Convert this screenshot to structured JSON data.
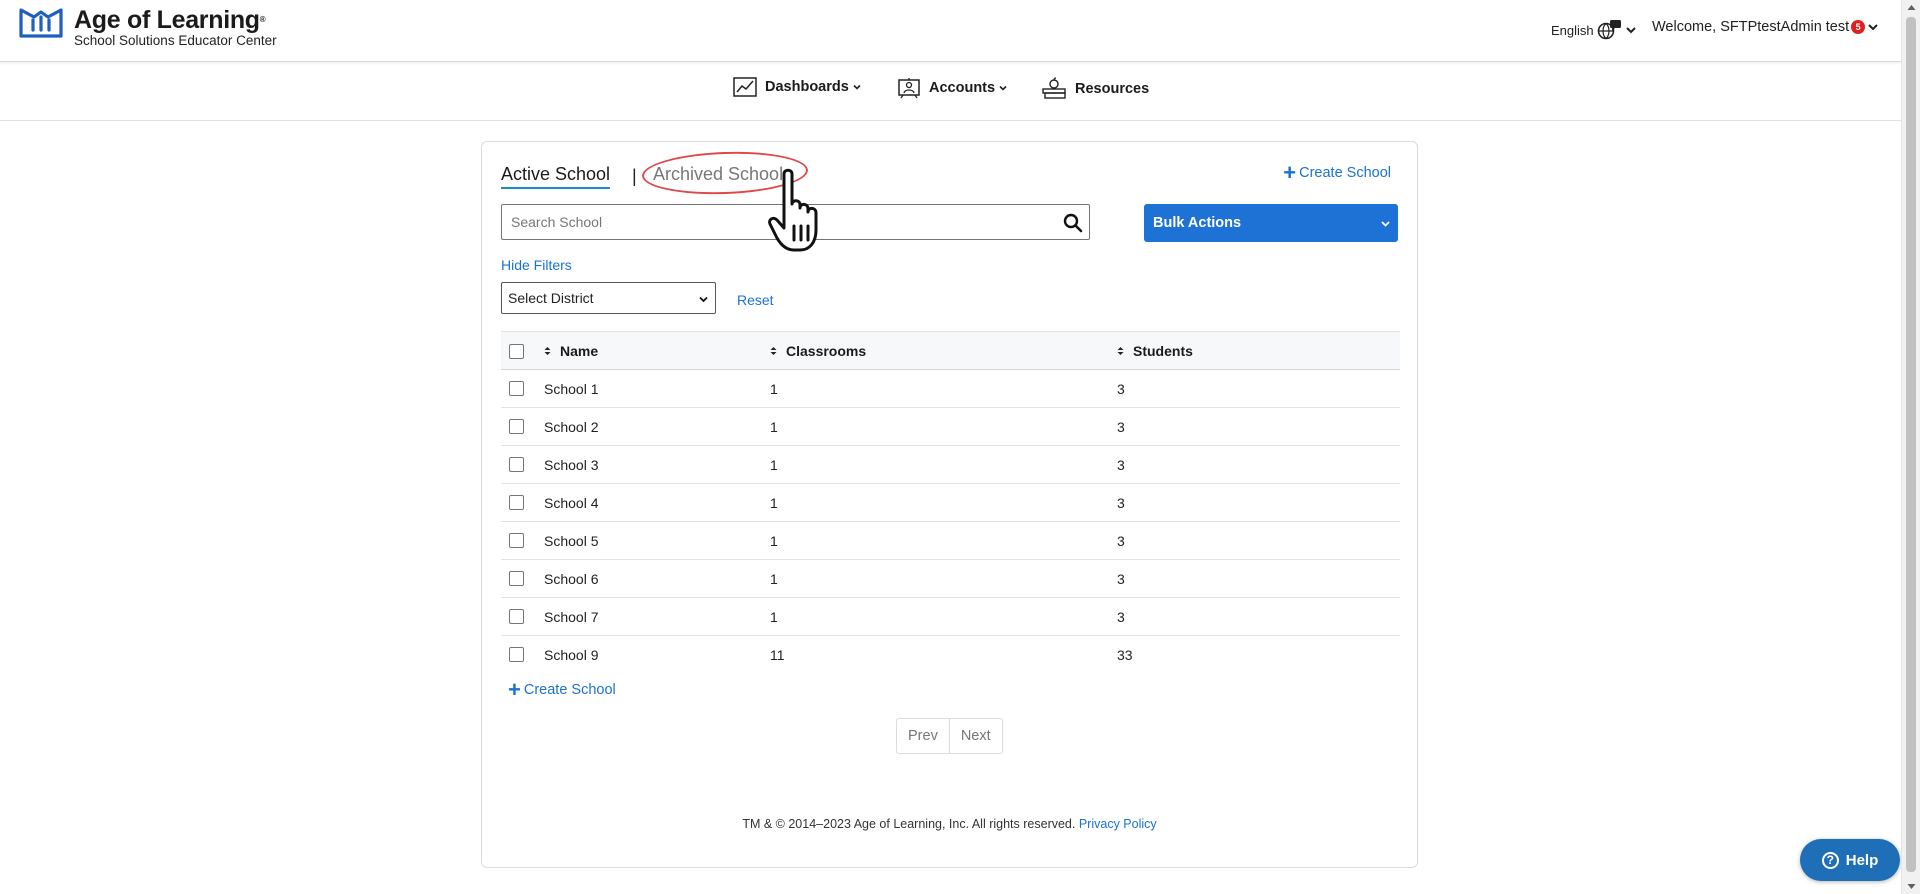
{
  "header": {
    "brand_name": "Age of Learning",
    "brand_trademark": "®",
    "brand_subtitle": "School Solutions Educator Center",
    "language": "English",
    "welcome": "Welcome, SFTPtestAdmin test",
    "notification_count": "5"
  },
  "nav": {
    "dashboards": "Dashboards",
    "accounts": "Accounts",
    "resources": "Resources"
  },
  "tabs": {
    "active": "Active School",
    "separator": "|",
    "archived": "Archived School"
  },
  "actions": {
    "create_school": "Create School",
    "bulk_actions": "Bulk Actions",
    "hide_filters": "Hide Filters",
    "reset": "Reset"
  },
  "search": {
    "placeholder": "Search School"
  },
  "filters": {
    "district_selected": "Select District"
  },
  "table": {
    "columns": [
      "Name",
      "Classrooms",
      "Students"
    ],
    "rows": [
      {
        "name": "School 1",
        "classrooms": "1",
        "students": "3"
      },
      {
        "name": "School 2",
        "classrooms": "1",
        "students": "3"
      },
      {
        "name": "School 3",
        "classrooms": "1",
        "students": "3"
      },
      {
        "name": "School 4",
        "classrooms": "1",
        "students": "3"
      },
      {
        "name": "School 5",
        "classrooms": "1",
        "students": "3"
      },
      {
        "name": "School 6",
        "classrooms": "1",
        "students": "3"
      },
      {
        "name": "School 7",
        "classrooms": "1",
        "students": "3"
      },
      {
        "name": "School 9",
        "classrooms": "11",
        "students": "33"
      }
    ]
  },
  "pagination": {
    "prev": "Prev",
    "next": "Next"
  },
  "footer": {
    "copyright": "TM & © 2014–2023 Age of Learning, Inc. All rights reserved.",
    "privacy": "Privacy Policy"
  },
  "help": {
    "label": "Help"
  },
  "colors": {
    "accent": "#1e72d6",
    "link": "#1b72d1",
    "highlight": "#e04848",
    "badge": "#e02020",
    "help": "#1e6fb8"
  }
}
